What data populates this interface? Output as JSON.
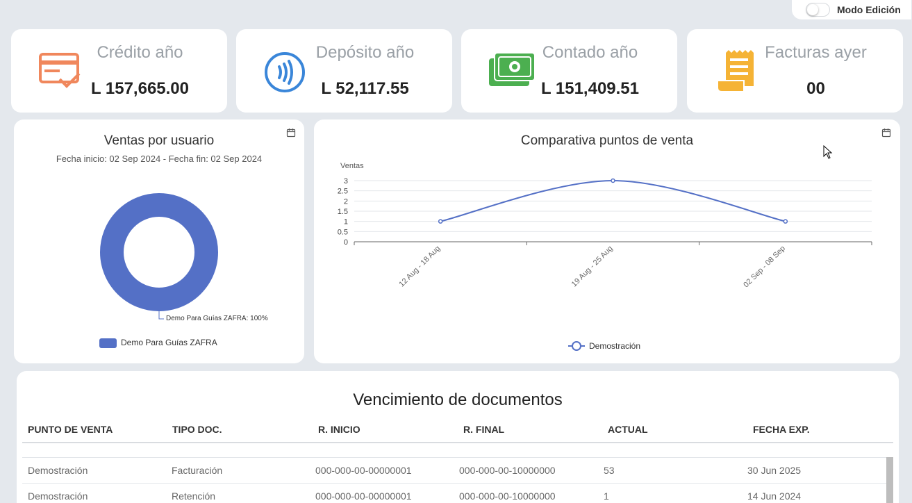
{
  "toolbar": {
    "mode_label": "Modo Edición"
  },
  "kpis": [
    {
      "title": "Crédito año",
      "value": "L 157,665.00",
      "icon": "credit-card-icon",
      "color": "#f0875c"
    },
    {
      "title": "Depósito año",
      "value": "L 52,117.55",
      "icon": "contactless-icon",
      "color": "#3a86d9"
    },
    {
      "title": "Contado año",
      "value": "L 151,409.51",
      "icon": "cash-icon",
      "color": "#4caf50"
    },
    {
      "title": "Facturas ayer",
      "value": "00",
      "icon": "receipt-icon",
      "color": "#f5b335"
    }
  ],
  "ventas_usuario": {
    "title": "Ventas por usuario",
    "subtitle": "Fecha inicio: 02 Sep 2024 - Fecha fin: 02 Sep 2024",
    "calendar_icon": "calendar-icon"
  },
  "comparativa": {
    "title": "Comparativa puntos de venta",
    "calendar_icon": "calendar-icon"
  },
  "chart_data": [
    {
      "type": "pie",
      "categories": [
        "Demo Para Guías ZAFRA"
      ],
      "values": [
        100
      ],
      "slice_label": "Demo Para Guías ZAFRA: 100%",
      "legend": "Demo Para Guías ZAFRA",
      "legend_position": "bottom",
      "color": "#5470c6"
    },
    {
      "type": "line",
      "ylabel": "Ventas",
      "categories": [
        "12 Aug - 18 Aug",
        "19 Aug - 25 Aug",
        "02 Sep - 08 Sep"
      ],
      "series": [
        {
          "name": "Demostración",
          "values": [
            1,
            3,
            1
          ]
        }
      ],
      "ylim": [
        0,
        3
      ],
      "yticks": [
        "0",
        "0.5",
        "1",
        "1.5",
        "2",
        "2.5",
        "3"
      ],
      "grid": true,
      "legend_position": "bottom",
      "color": "#5470c6"
    }
  ],
  "documentos": {
    "title": "Vencimiento de documentos",
    "headers": [
      "PUNTO DE VENTA",
      "TIPO DOC.",
      "R. INICIO",
      "R. FINAL",
      "ACTUAL",
      "FECHA EXP."
    ],
    "rows": [
      [
        "Demostración",
        "Facturación",
        "000-000-00-00000001",
        "000-000-00-10000000",
        "53",
        "30 Jun 2025"
      ],
      [
        "Demostración",
        "Retención",
        "000-000-00-00000001",
        "000-000-00-10000000",
        "1",
        "14 Jun 2024"
      ]
    ]
  }
}
